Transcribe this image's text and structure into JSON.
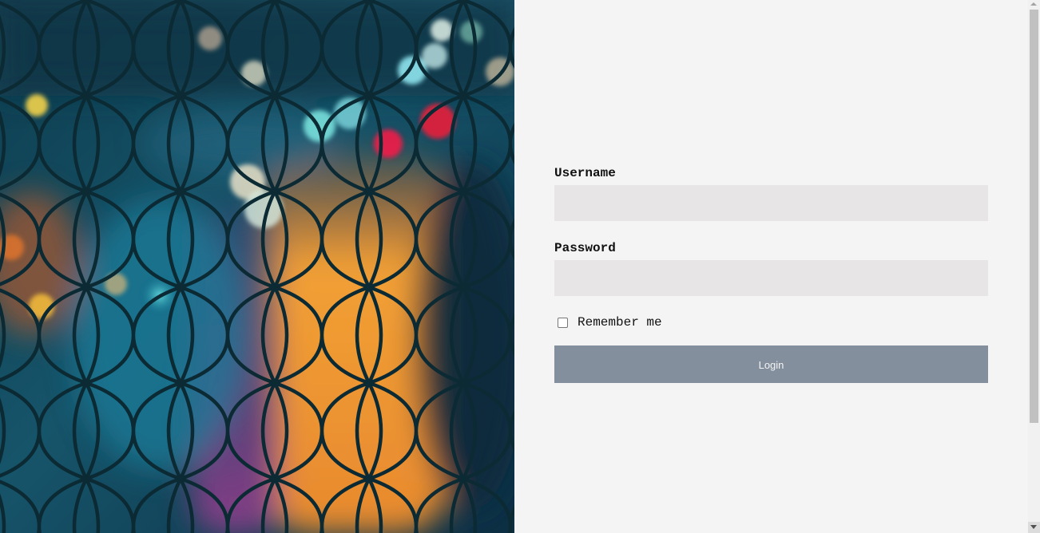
{
  "hero": {
    "image_description_icon": "chain-link-fence-bokeh-photo"
  },
  "form": {
    "username_label": "Username",
    "username_value": "",
    "username_placeholder": "",
    "password_label": "Password",
    "password_value": "",
    "password_placeholder": "",
    "remember_label": "Remember me",
    "remember_checked": false,
    "login_label": "Login"
  },
  "colors": {
    "panel_bg": "#f4f4f4",
    "field_bg": "#e7e5e5",
    "button_bg": "#838f9d",
    "button_text": "#f4f4f4"
  }
}
